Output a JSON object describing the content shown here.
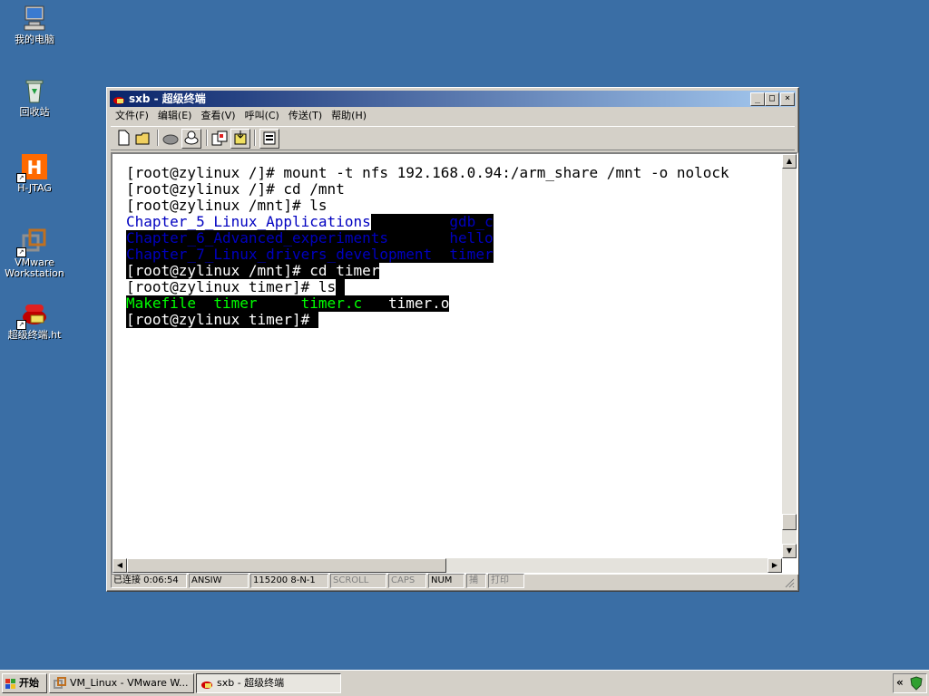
{
  "desktop": {
    "icons": [
      {
        "label": "我的电脑",
        "icon": "my-computer-icon"
      },
      {
        "label": "回收站",
        "icon": "recycle-bin-icon"
      },
      {
        "label": "H-JTAG",
        "icon": "hjtag-icon"
      },
      {
        "label": "VMware Workstation",
        "icon": "vmware-icon"
      },
      {
        "label": "超级终端.ht",
        "icon": "hyperterminal-icon"
      }
    ]
  },
  "window": {
    "title": "sxb - 超级终端",
    "controls": {
      "minimize": "_",
      "maximize": "□",
      "close": "×"
    },
    "menu": [
      "文件(F)",
      "编辑(E)",
      "查看(V)",
      "呼叫(C)",
      "传送(T)",
      "帮助(H)"
    ],
    "toolbar_icons": [
      "new-icon",
      "open-icon",
      "disconnect-icon",
      "dial-icon",
      "send-icon",
      "receive-icon",
      "properties-icon"
    ]
  },
  "terminal": {
    "lines": [
      {
        "segments": [
          {
            "text": "[root@zylinux /]# mount -t nfs 192.168.0.94:/arm_share /mnt -o nolock",
            "style": "fg-black"
          }
        ]
      },
      {
        "segments": [
          {
            "text": "[root@zylinux /]# cd /mnt",
            "style": "fg-black"
          }
        ]
      },
      {
        "segments": [
          {
            "text": "[root@zylinux /mnt]# ls",
            "style": "fg-black"
          }
        ]
      },
      {
        "segments": [
          {
            "text": "Chapter_5_Linux_Applications",
            "style": "blue"
          },
          {
            "text": "         gdb_c",
            "style": "sel blue"
          }
        ]
      },
      {
        "segments": [
          {
            "text": "Chapter_6_Advanced_experiments       hello",
            "style": "sel blue"
          }
        ]
      },
      {
        "segments": [
          {
            "text": "Chapter_7_Linux_drivers_development  timer",
            "style": "sel blue"
          }
        ]
      },
      {
        "segments": [
          {
            "text": "[root@zylinux /mnt]# cd timer",
            "style": "sel"
          }
        ]
      },
      {
        "segments": [
          {
            "text": "[root@zylinux timer]# ls",
            "style": "fg-black"
          },
          {
            "text": " ",
            "style": "sel"
          }
        ]
      },
      {
        "segments": [
          {
            "text": "Makefile  timer     timer.c   ",
            "style": "sel green"
          },
          {
            "text": "timer.o",
            "style": "sel"
          }
        ]
      },
      {
        "segments": [
          {
            "text": "[root@zylinux timer]# ",
            "style": "sel"
          }
        ]
      }
    ]
  },
  "status": {
    "connected": "已连接 0:06:54",
    "emulation": "ANSIW",
    "port": "115200 8-N-1",
    "scroll": "SCROLL",
    "caps": "CAPS",
    "num": "NUM",
    "capture": "捕",
    "print": "打印"
  },
  "taskbar": {
    "start": "开始",
    "tasks": [
      {
        "label": "VM_Linux - VMware W...",
        "icon": "vmware-task-icon"
      },
      {
        "label": "sxb - 超级终端",
        "icon": "hyperterminal-task-icon"
      }
    ],
    "tray_icons": [
      "chevron-left-icon",
      "shield-icon"
    ],
    "tray_chevron": "«"
  }
}
